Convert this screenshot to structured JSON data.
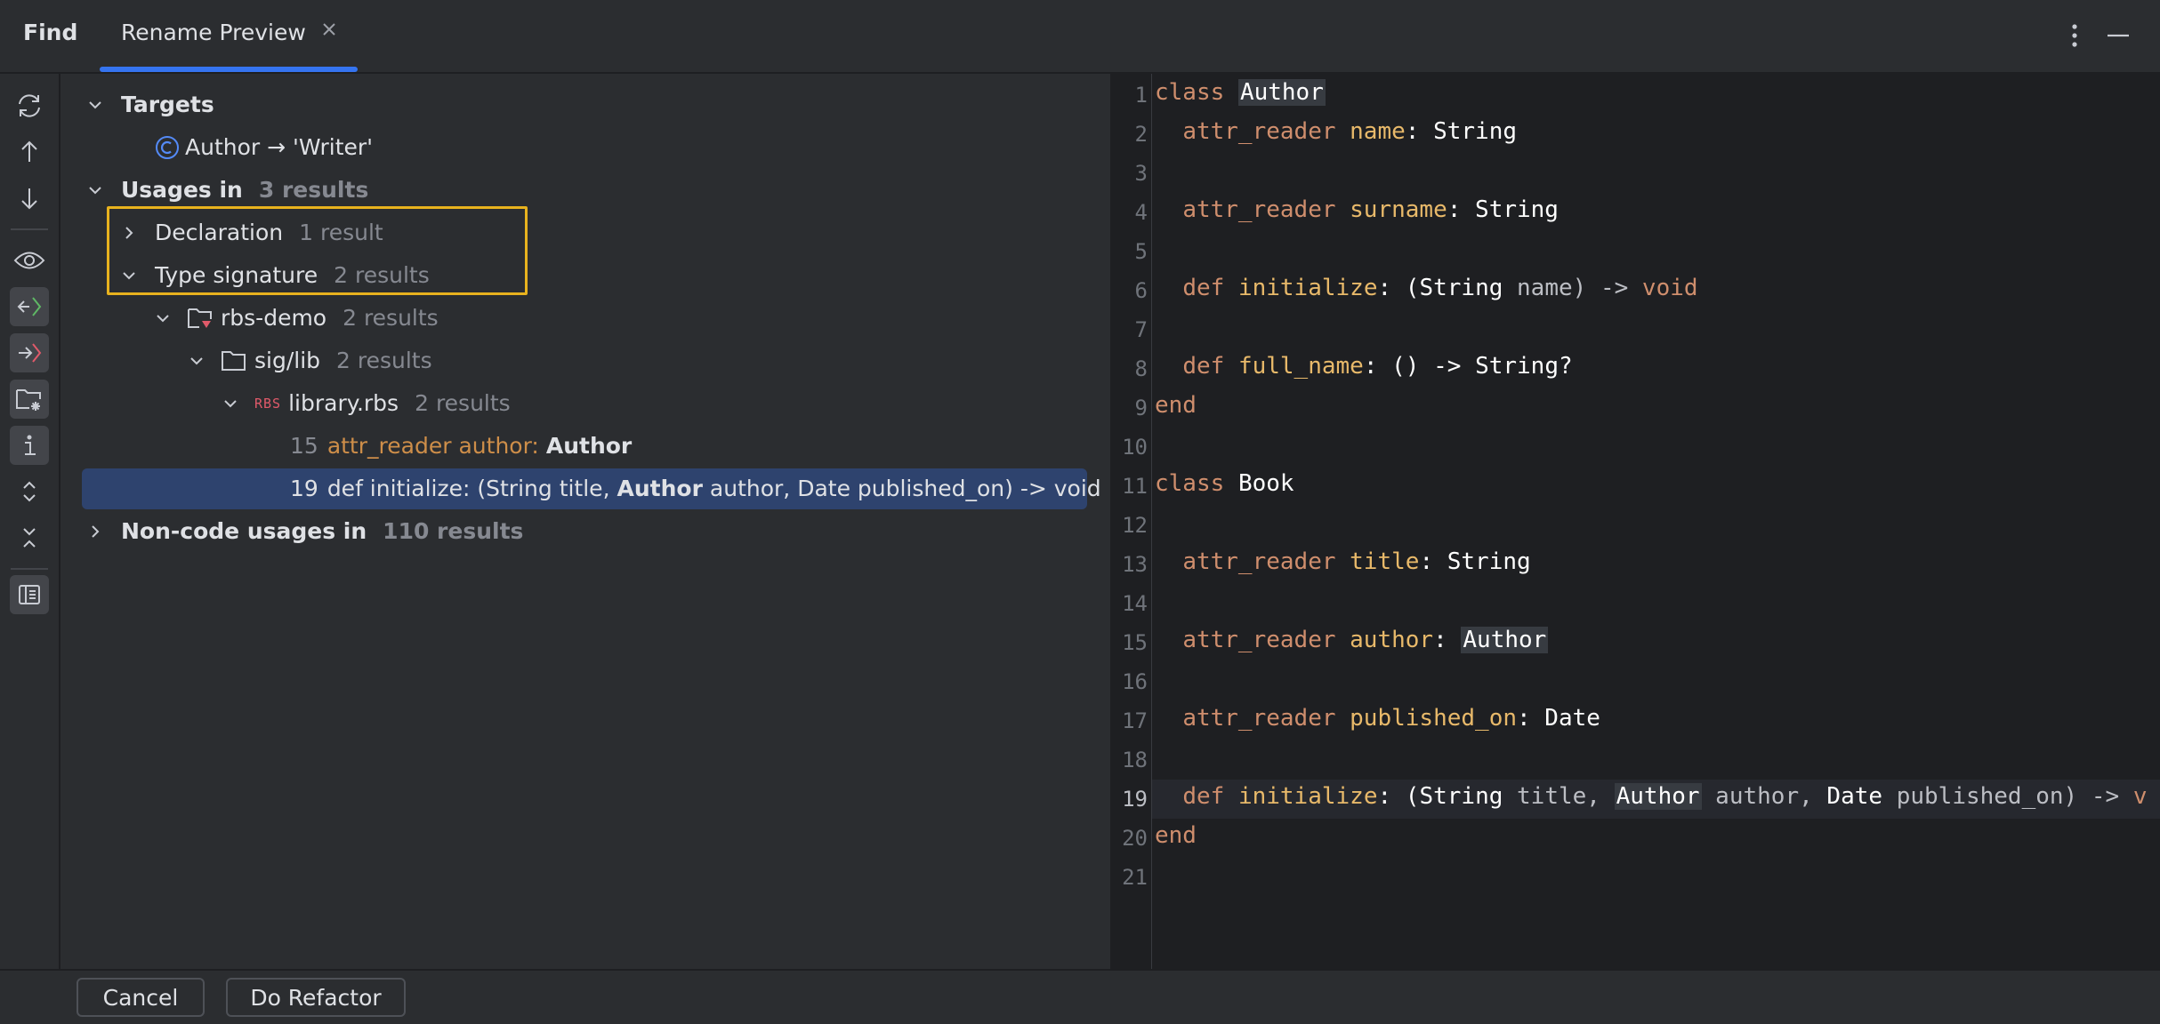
{
  "header": {
    "find_label": "Find",
    "tab_label": "Rename Preview",
    "tab_close_icon": "close-icon",
    "more_icon": "more-vertical-icon",
    "minimize_icon": "minimize-icon"
  },
  "colors": {
    "accent": "#3574f0",
    "highlight_box": "#e8b21e",
    "selection": "#2e436e",
    "keyword": "#cf8e6d",
    "identifier": "#e8b96a"
  },
  "toolbar": {
    "icons": [
      "refresh-icon",
      "arrow-up-icon",
      "arrow-down-icon",
      "eye-icon",
      "import-icon",
      "export-icon",
      "folder-settings-icon",
      "info-icon",
      "expand-all-icon",
      "collapse-all-icon",
      "preview-panel-icon"
    ]
  },
  "tree": {
    "targets_label": "Targets",
    "target_item": "Author → 'Writer'",
    "usages_label": "Usages in",
    "usages_count": "3 results",
    "declaration_label": "Declaration",
    "declaration_count": "1 result",
    "type_signature_label": "Type signature",
    "type_signature_count": "2 results",
    "rbs_demo_label": "rbs-demo",
    "rbs_demo_count": "2 results",
    "sig_lib_label": "sig/lib",
    "sig_lib_count": "2 results",
    "file_badge": "RBS",
    "file_label": "library.rbs",
    "file_count": "2 results",
    "usage1": {
      "line": "15",
      "kw": "attr_reader",
      "name": "author:",
      "type": "Author"
    },
    "usage2": {
      "line": "19",
      "pre": "def initialize: (String title,",
      "type": "Author",
      "post": "author, Date published_on) -> void"
    },
    "noncode_label": "Non-code usages in",
    "noncode_count": "110 results"
  },
  "editor": {
    "line_numbers": [
      "1",
      "2",
      "3",
      "4",
      "5",
      "6",
      "7",
      "8",
      "9",
      "10",
      "11",
      "12",
      "13",
      "14",
      "15",
      "16",
      "17",
      "18",
      "19",
      "20",
      "21"
    ],
    "current_line": "19",
    "code": {
      "l1": {
        "kw": "class",
        "name": "Author"
      },
      "l2": {
        "kw": "attr_reader",
        "id": "name",
        "rest": ": String"
      },
      "l4": {
        "kw": "attr_reader",
        "id": "surname",
        "rest": ": String"
      },
      "l6": {
        "kw": "def",
        "id": "initialize",
        "p1": ": (",
        "t1": "String",
        "p2": " name) -> ",
        "kw2": "void"
      },
      "l8": {
        "kw": "def",
        "id": "full_name",
        "p1": ": () -> ",
        "t1": "String",
        "p2": "?"
      },
      "l9": {
        "kw": "end"
      },
      "l11": {
        "kw": "class",
        "name": "Book"
      },
      "l13": {
        "kw": "attr_reader",
        "id": "title",
        "rest": ": String"
      },
      "l15": {
        "kw": "attr_reader",
        "id": "author",
        "p1": ": ",
        "hl": "Author"
      },
      "l17": {
        "kw": "attr_reader",
        "id": "published_on",
        "rest": ": Date"
      },
      "l19": {
        "kw": "def",
        "id": "initialize",
        "p1": ": (",
        "t1": "String",
        "p2": " title, ",
        "hl": "Author",
        "p3": " author, ",
        "t2": "Date",
        "p4": " published_on) -> ",
        "kw2": "v"
      },
      "l20": {
        "kw": "end"
      }
    }
  },
  "bottom": {
    "cancel_label": "Cancel",
    "refactor_label": "Do Refactor"
  }
}
